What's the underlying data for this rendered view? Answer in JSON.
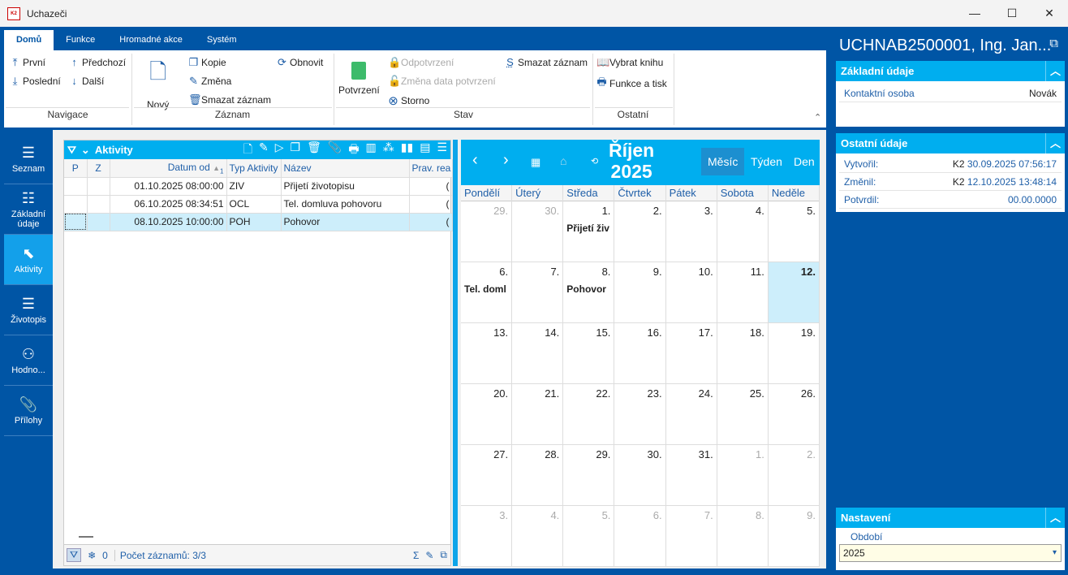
{
  "window": {
    "title": "Uchazeči",
    "logo": "K2",
    "minimize": "—",
    "maximize": "☐",
    "close": "✕"
  },
  "ribbon": {
    "tabs": [
      "Domů",
      "Funkce",
      "Hromadné akce",
      "Systém"
    ],
    "nav": {
      "first": "První",
      "last": "Poslední",
      "prev": "Předchozí",
      "next": "Další",
      "group": "Navigace"
    },
    "record": {
      "new": "Nový",
      "copy": "Kopie",
      "change": "Změna",
      "delete": "Smazat záznam",
      "refresh": "Obnovit",
      "group": "Záznam"
    },
    "state": {
      "confirm": "Potvrzení",
      "unconfirm": "Odpotvrzení",
      "change_date": "Změna data potvrzení",
      "cancel": "Storno",
      "delete": "Smazat záznam",
      "group": "Stav"
    },
    "other": {
      "choose_book": "Vybrat knihu",
      "functions": "Funkce a tisk",
      "group": "Ostatní"
    }
  },
  "sidebar": {
    "items": [
      {
        "label": "Seznam"
      },
      {
        "label": "Základní údaje"
      },
      {
        "label": "Aktivity"
      },
      {
        "label": "Životopis"
      },
      {
        "label": "Hodno..."
      },
      {
        "label": "Přílohy"
      }
    ]
  },
  "grid": {
    "title": "Aktivity",
    "columns": [
      "P",
      "Z",
      "Datum od",
      "Typ Aktivity",
      "Název",
      "Prav. rea"
    ],
    "sort_index": "1",
    "rows": [
      {
        "date": "01.10.2025 08:00:00",
        "type": "ZIV",
        "name": "Přijetí životopisu",
        "extra": "("
      },
      {
        "date": "06.10.2025 08:34:51",
        "type": "OCL",
        "name": "Tel. domluva pohovoru",
        "extra": "("
      },
      {
        "date": "08.10.2025 10:00:00",
        "type": "POH",
        "name": "Pohovor",
        "extra": "("
      }
    ],
    "footer": {
      "count_value": "0",
      "records": "Počet záznamů: 3/3"
    }
  },
  "calendar": {
    "month": "Říjen",
    "year": "2025",
    "views": [
      "Měsíc",
      "Týden",
      "Den"
    ],
    "day_names": [
      "Pondělí",
      "Úterý",
      "Středa",
      "Čtvrtek",
      "Pátek",
      "Sobota",
      "Neděle"
    ],
    "days": [
      {
        "n": "29.",
        "o": true
      },
      {
        "n": "30.",
        "o": true
      },
      {
        "n": "1.",
        "ev": "Přijetí živ"
      },
      {
        "n": "2."
      },
      {
        "n": "3."
      },
      {
        "n": "4."
      },
      {
        "n": "5."
      },
      {
        "n": "6.",
        "ev": "Tel. doml"
      },
      {
        "n": "7."
      },
      {
        "n": "8.",
        "ev": "Pohovor"
      },
      {
        "n": "9."
      },
      {
        "n": "10."
      },
      {
        "n": "11."
      },
      {
        "n": "12.",
        "today": true
      },
      {
        "n": "13."
      },
      {
        "n": "14."
      },
      {
        "n": "15."
      },
      {
        "n": "16."
      },
      {
        "n": "17."
      },
      {
        "n": "18."
      },
      {
        "n": "19."
      },
      {
        "n": "20."
      },
      {
        "n": "21."
      },
      {
        "n": "22."
      },
      {
        "n": "23."
      },
      {
        "n": "24."
      },
      {
        "n": "25."
      },
      {
        "n": "26."
      },
      {
        "n": "27."
      },
      {
        "n": "28."
      },
      {
        "n": "29."
      },
      {
        "n": "30."
      },
      {
        "n": "31."
      },
      {
        "n": "1.",
        "o": true
      },
      {
        "n": "2.",
        "o": true
      },
      {
        "n": "3.",
        "o": true
      },
      {
        "n": "4.",
        "o": true
      },
      {
        "n": "5.",
        "o": true
      },
      {
        "n": "6.",
        "o": true
      },
      {
        "n": "7.",
        "o": true
      },
      {
        "n": "8.",
        "o": true
      },
      {
        "n": "9.",
        "o": true
      }
    ]
  },
  "detail": {
    "title": "UCHNAB2500001, Ing. Jan...",
    "basic": {
      "header": "Základní údaje",
      "contact_label": "Kontaktní osoba",
      "contact_value": "Novák"
    },
    "other": {
      "header": "Ostatní údaje",
      "created_label": "Vytvořil:",
      "created_user": "K2",
      "created_value": "30.09.2025 07:56:17",
      "changed_label": "Změnil:",
      "changed_user": "K2",
      "changed_value": "12.10.2025 13:48:14",
      "confirmed_label": "Potvrdil:",
      "confirmed_value": "00.00.0000"
    },
    "settings": {
      "header": "Nastavení",
      "period_label": "Období",
      "period_value": "2025"
    }
  }
}
